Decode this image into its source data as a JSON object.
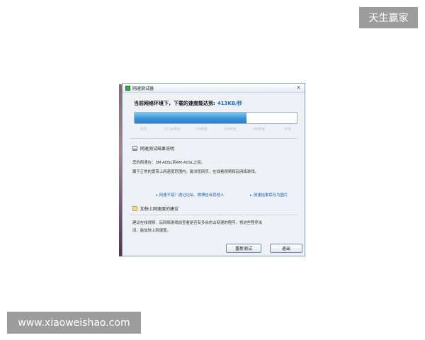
{
  "watermark_top": "天生赢家",
  "watermark_bottom": "www.xiaoweishao.com",
  "window": {
    "title": "网速测试器",
    "close_symbol": "×",
    "headline": "当前网络环境下，下载的速度能达到:",
    "speed": "413KB/秒",
    "progress_fraction": 0.69,
    "ticks": [
      "拨号",
      "512K带宽",
      "1M带宽",
      "2M带宽",
      "4M带宽",
      "专线"
    ],
    "result_heading": "网速测试结果说明",
    "result_line1": "您的网速在：3M ADSL到4M ADSL之间。",
    "result_line2": "属于正常的宽带上网速度范围内，能浏览网页，在线看视频和玩网络游戏。",
    "link_share": "网速不错？通过论坛、微博告诉其他人",
    "link_save": "测速结果保存为图片",
    "tips_heading": "加快上网速度的建议",
    "tips_line1": "建议在线视频、玩网络游戏前查看是否有多余的占网速的程序，将这些程序关",
    "tips_line2": "闭，能加快上网速度。",
    "retest_button": "重新测试",
    "exit_button": "退出"
  },
  "colors": {
    "progress_fill": "#3f96d8",
    "link": "#1d5fa8",
    "speed": "#1d6fb8"
  },
  "icons": [
    "app-icon",
    "close-icon",
    "chart-icon",
    "folder-icon",
    "arrow-icon"
  ]
}
